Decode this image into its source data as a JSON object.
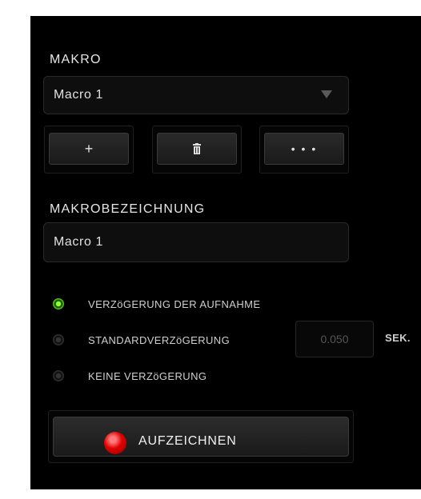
{
  "macro_section": {
    "title": "MAKRO",
    "selected_macro": "Macro 1"
  },
  "toolbar": {
    "add_label": "+",
    "delete_icon": "trash-icon",
    "more_label": "• • •"
  },
  "name_section": {
    "title": "MAKROBEZEICHNUNG",
    "value": "Macro 1"
  },
  "delay_options": [
    {
      "label": "VERZöGERUNG DER AUFNAHME",
      "selected": true
    },
    {
      "label": "STANDARDVERZöGERUNG",
      "selected": false
    },
    {
      "label": "KEINE VERZöGERUNG",
      "selected": false
    }
  ],
  "default_delay": {
    "value": "0.050",
    "unit": "SEK."
  },
  "record_button": {
    "label": "AUFZEICHNEN"
  },
  "colors": {
    "accent_green": "#44d62c",
    "record_red": "#e00000",
    "background": "#000000"
  }
}
